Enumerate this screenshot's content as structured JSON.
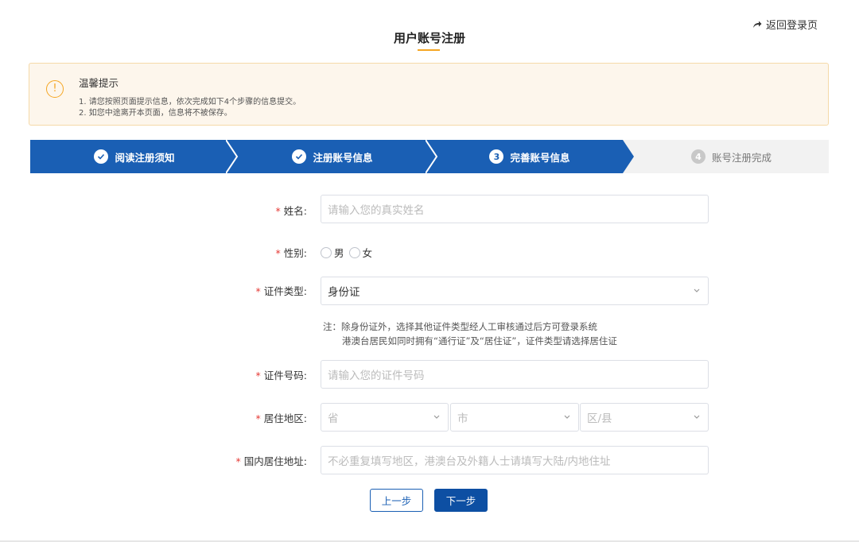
{
  "header": {
    "return_label": "返回登录页",
    "title": "用户账号注册"
  },
  "tip": {
    "title": "温馨提示",
    "line1": "1. 请您按照页面提示信息，依次完成如下4个步骤的信息提交。",
    "line2": "2. 如您中途离开本页面，信息将不被保存。",
    "icon": "!"
  },
  "steps": [
    {
      "label": "阅读注册须知",
      "state": "done"
    },
    {
      "label": "注册账号信息",
      "state": "done"
    },
    {
      "label": "完善账号信息",
      "state": "current",
      "number": "3"
    },
    {
      "label": "账号注册完成",
      "state": "pending",
      "number": "4"
    }
  ],
  "form": {
    "name": {
      "required": "*",
      "label": "姓名:",
      "placeholder": "请输入您的真实姓名"
    },
    "gender": {
      "required": "*",
      "label": "性别:",
      "options": [
        "男",
        "女"
      ]
    },
    "id_type": {
      "required": "*",
      "label": "证件类型:",
      "value": "身份证"
    },
    "note": {
      "line1": "注：除身份证外，选择其他证件类型经人工审核通过后方可登录系统",
      "line2": "港澳台居民如同时拥有“通行证”及“居住证”，证件类型请选择居住证"
    },
    "id_number": {
      "required": "*",
      "label": "证件号码:",
      "placeholder": "请输入您的证件号码"
    },
    "region": {
      "required": "*",
      "label": "居住地区:",
      "province": "省",
      "city": "市",
      "district": "区/县"
    },
    "address": {
      "required": "*",
      "label": "国内居住地址:",
      "placeholder": "不必重复填写地区，港澳台及外籍人士请填写大陆/内地住址"
    }
  },
  "buttons": {
    "prev": "上一步",
    "next": "下一步"
  },
  "colors": {
    "primary": "#0d4fa3",
    "accent": "#f5a623",
    "required": "#e53935"
  }
}
